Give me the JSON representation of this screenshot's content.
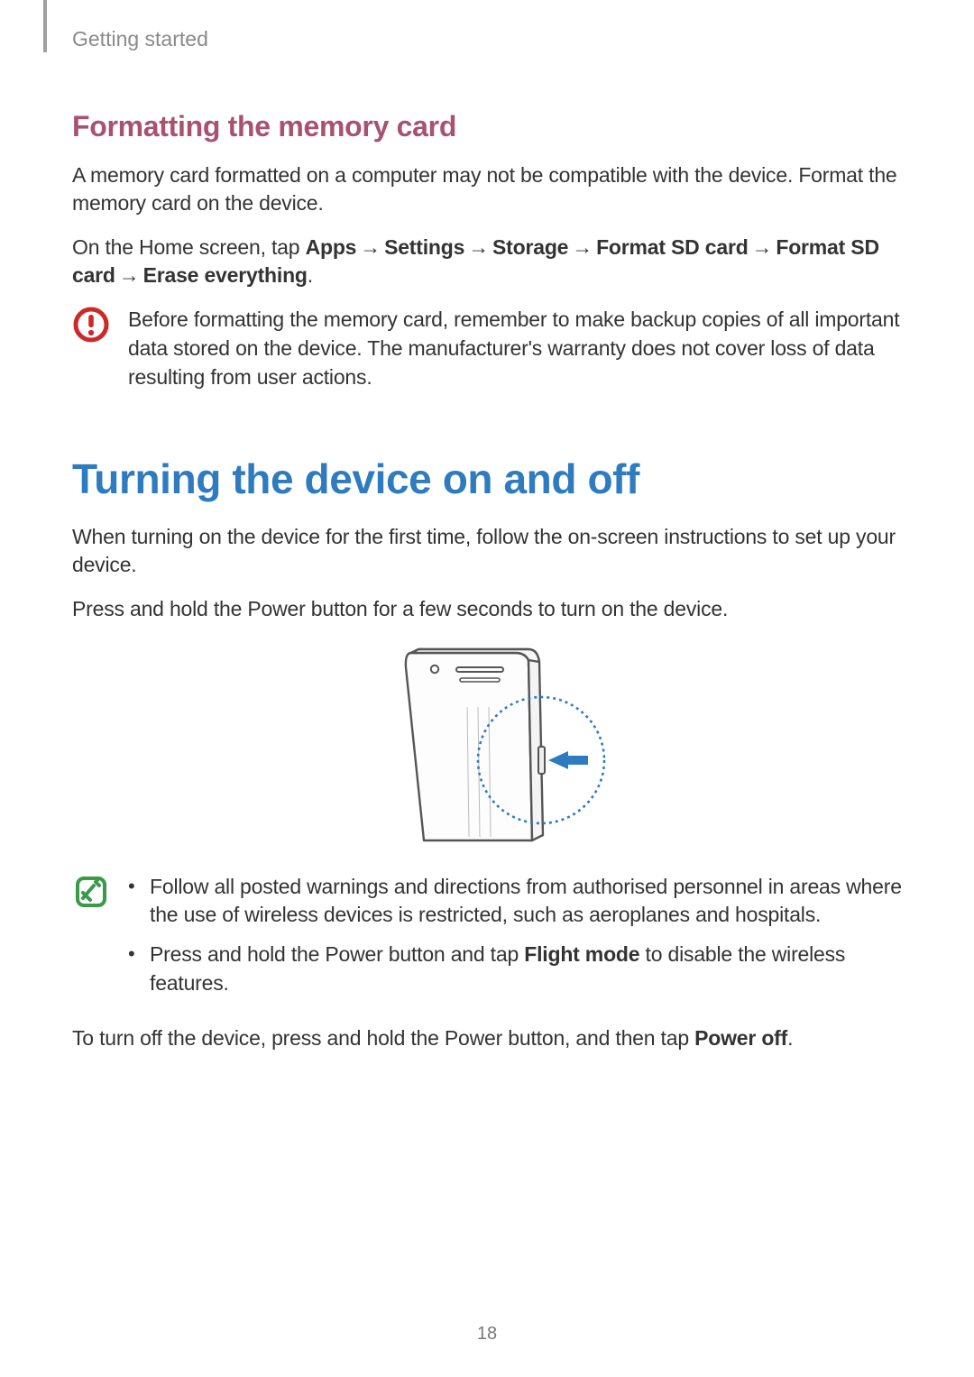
{
  "header": {
    "section": "Getting started"
  },
  "sec1": {
    "heading": "Formatting the memory card",
    "p1": "A memory card formatted on a computer may not be compatible with the device. Format the memory card on the device.",
    "p2_lead": "On the Home screen, tap ",
    "p2_b1": "Apps",
    "p2_b2": "Settings",
    "p2_b3": "Storage",
    "p2_b4": "Format SD card",
    "p2_b5": "Format SD card",
    "p2_b6": "Erase everything",
    "p2_period": ".",
    "arrow": "→",
    "caution": "Before formatting the memory card, remember to make backup copies of all important data stored on the device. The manufacturer's warranty does not cover loss of data resulting from user actions."
  },
  "sec2": {
    "heading": "Turning the device on and off",
    "p1": "When turning on the device for the first time, follow the on-screen instructions to set up your device.",
    "p2": "Press and hold the Power button for a few seconds to turn on the device.",
    "note1": "Follow all posted warnings and directions from authorised personnel in areas where the use of wireless devices is restricted, such as aeroplanes and hospitals.",
    "note2a": "Press and hold the Power button and tap ",
    "note2b": "Flight mode",
    "note2c": " to disable the wireless features.",
    "p3a": "To turn off the device, press and hold the Power button, and then tap ",
    "p3b": "Power off",
    "p3c": "."
  },
  "page_number": "18"
}
